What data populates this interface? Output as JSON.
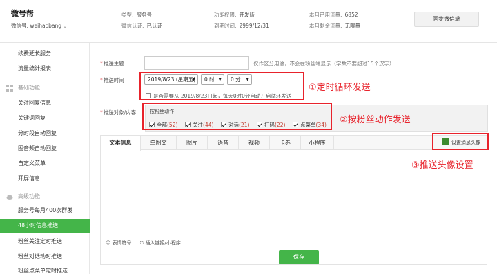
{
  "header": {
    "brand": "微号帮",
    "wx_id_label": "微信号: weihaobang",
    "type_label": "类型:",
    "type_value": "服务号",
    "verify_label": "微信认证:",
    "verify_value": "已认证",
    "perm_label": "功能权限:",
    "perm_value": "开发版",
    "expire_label": "到期时间:",
    "expire_value": "2999/12/31",
    "flow_used_label": "本月已用流量:",
    "flow_used_value": "6852",
    "flow_left_label": "本月剩余流量:",
    "flow_left_value": "无限量",
    "sync_button": "同步微信端"
  },
  "sidebar": {
    "items": [
      {
        "label": "续费延长服务"
      },
      {
        "label": "流量统计报表"
      },
      {
        "label": "关注回复信息"
      },
      {
        "label": "关键词回复"
      },
      {
        "label": "分时段自动回复"
      },
      {
        "label": "图音频自动回复"
      },
      {
        "label": "自定义菜单"
      },
      {
        "label": "开屏信息"
      },
      {
        "label": "服务号每月400次群发"
      },
      {
        "label": "48小时信息推送"
      },
      {
        "label": "粉丝关注定时推送"
      },
      {
        "label": "粉丝对话动时推送"
      },
      {
        "label": "粉丝点菜单定时推送"
      }
    ],
    "group_basic": "基础功能",
    "group_advanced": "高级功能"
  },
  "form": {
    "topic_label": "推送主题",
    "topic_hint": "仅作区分用途，不会在粉丝端显示（字数不要超过15个汉字）",
    "time_label": "推送时间",
    "date_value": "2019/8/23 (星期五)",
    "hour_value": "0 时",
    "minute_value": "0 分",
    "repeat_text": "是否需要从 2019/8/23日起，每天0时0分自动开启循环发送",
    "target_label": "推送对象/内容",
    "action_title": "按粉丝动作",
    "actions": [
      {
        "label": "全部",
        "count": "(52)"
      },
      {
        "label": "关注",
        "count": "(44)"
      },
      {
        "label": "对话",
        "count": "(21)"
      },
      {
        "label": "扫码",
        "count": "(22)"
      },
      {
        "label": "点菜单",
        "count": "(34)"
      }
    ]
  },
  "annotations": {
    "a1": "①定时循环发送",
    "a2": "②按粉丝动作发送",
    "a3": "③推送头像设置"
  },
  "editor": {
    "tabs": [
      "文本信息",
      "单图文",
      "图片",
      "语音",
      "视频",
      "卡券",
      "小程序"
    ],
    "avatar_button": "设置消息头像",
    "emoji_label": "表情符号",
    "link_label": "插入链接/小程序"
  },
  "save_button": "保存",
  "colors": {
    "accent": "#44b549",
    "annotation": "#e8232c"
  }
}
